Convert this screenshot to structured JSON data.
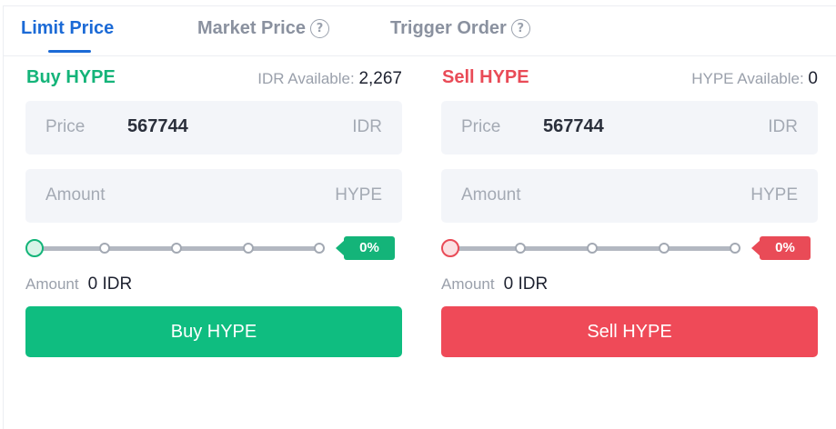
{
  "tabs": [
    {
      "label": "Limit Price",
      "active": true
    },
    {
      "label": "Market Price",
      "icon": "help-circle-icon"
    },
    {
      "label": "Trigger Order",
      "icon": "help-circle-icon"
    }
  ],
  "help_icon_glyph": "?",
  "buy": {
    "title": "Buy HYPE",
    "available_label": "IDR Available:",
    "available_value": "2,267",
    "price": {
      "label": "Price",
      "value": "567744",
      "unit": "IDR"
    },
    "amount": {
      "label": "Amount",
      "value": "",
      "unit": "HYPE"
    },
    "slider_percent_label": "0%",
    "slider_level": 0,
    "total_label": "Amount",
    "total_value": "0 IDR",
    "button_label": "Buy HYPE",
    "accent_color": "#14b479"
  },
  "sell": {
    "title": "Sell HYPE",
    "available_label": "HYPE Available:",
    "available_value": "0",
    "price": {
      "label": "Price",
      "value": "567744",
      "unit": "IDR"
    },
    "amount": {
      "label": "Amount",
      "value": "",
      "unit": "HYPE"
    },
    "slider_percent_label": "0%",
    "slider_level": 0,
    "total_label": "Amount",
    "total_value": "0 IDR",
    "button_label": "Sell HYPE",
    "accent_color": "#e94b57"
  },
  "colors": {
    "tab_active": "#1b6ad6",
    "buy_button": "#0fbd80",
    "sell_button": "#ef4a58"
  }
}
